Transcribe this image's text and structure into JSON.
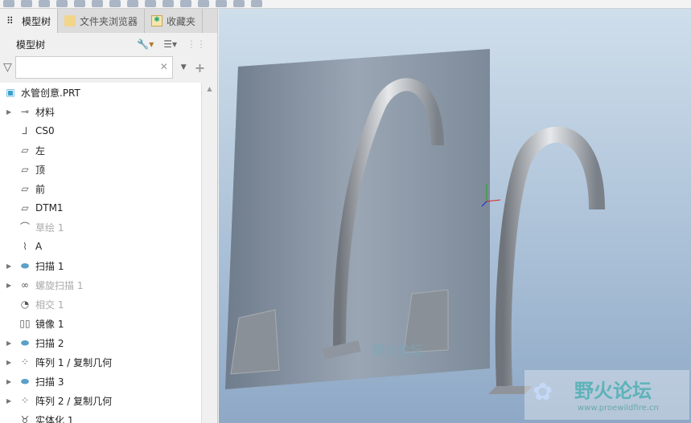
{
  "tabs": [
    {
      "label": "模型树",
      "icon": "model-tree-icon"
    },
    {
      "label": "文件夹浏览器",
      "icon": "folder-icon"
    },
    {
      "label": "收藏夹",
      "icon": "favorites-icon"
    }
  ],
  "tree_header": "模型树",
  "filter": {
    "value": "",
    "placeholder": ""
  },
  "tree": [
    {
      "label": "水管创意.PRT",
      "icon": "part-icon",
      "expand": false,
      "dim": false,
      "root": true
    },
    {
      "label": "材料",
      "icon": "material-icon",
      "expand": true,
      "dim": false
    },
    {
      "label": "CS0",
      "icon": "csys-icon",
      "expand": false,
      "dim": false
    },
    {
      "label": "左",
      "icon": "plane-icon",
      "expand": false,
      "dim": false
    },
    {
      "label": "顶",
      "icon": "plane-icon",
      "expand": false,
      "dim": false
    },
    {
      "label": "前",
      "icon": "plane-icon",
      "expand": false,
      "dim": false
    },
    {
      "label": "DTM1",
      "icon": "plane-icon",
      "expand": false,
      "dim": false
    },
    {
      "label": "草绘 1",
      "icon": "sketch-icon",
      "expand": false,
      "dim": true
    },
    {
      "label": "A",
      "icon": "graph-icon",
      "expand": false,
      "dim": false
    },
    {
      "label": "扫描 1",
      "icon": "sweep-icon",
      "expand": true,
      "dim": false
    },
    {
      "label": "螺旋扫描 1",
      "icon": "helical-sweep-icon",
      "expand": true,
      "dim": true
    },
    {
      "label": "相交 1",
      "icon": "intersect-icon",
      "expand": false,
      "dim": true
    },
    {
      "label": "镜像 1",
      "icon": "mirror-icon",
      "expand": false,
      "dim": false
    },
    {
      "label": "扫描 2",
      "icon": "sweep-icon",
      "expand": true,
      "dim": false
    },
    {
      "label": "阵列 1 / 复制几何",
      "icon": "pattern-icon",
      "expand": true,
      "dim": false
    },
    {
      "label": "扫描 3",
      "icon": "sweep-icon",
      "expand": true,
      "dim": false
    },
    {
      "label": "阵列 2 / 复制几何",
      "icon": "pattern-icon",
      "expand": true,
      "dim": false
    },
    {
      "label": "实体化 1",
      "icon": "solidify-icon",
      "expand": false,
      "dim": false
    }
  ],
  "watermark": {
    "title": "野火论坛",
    "url": "www.proewildfire.cn"
  }
}
